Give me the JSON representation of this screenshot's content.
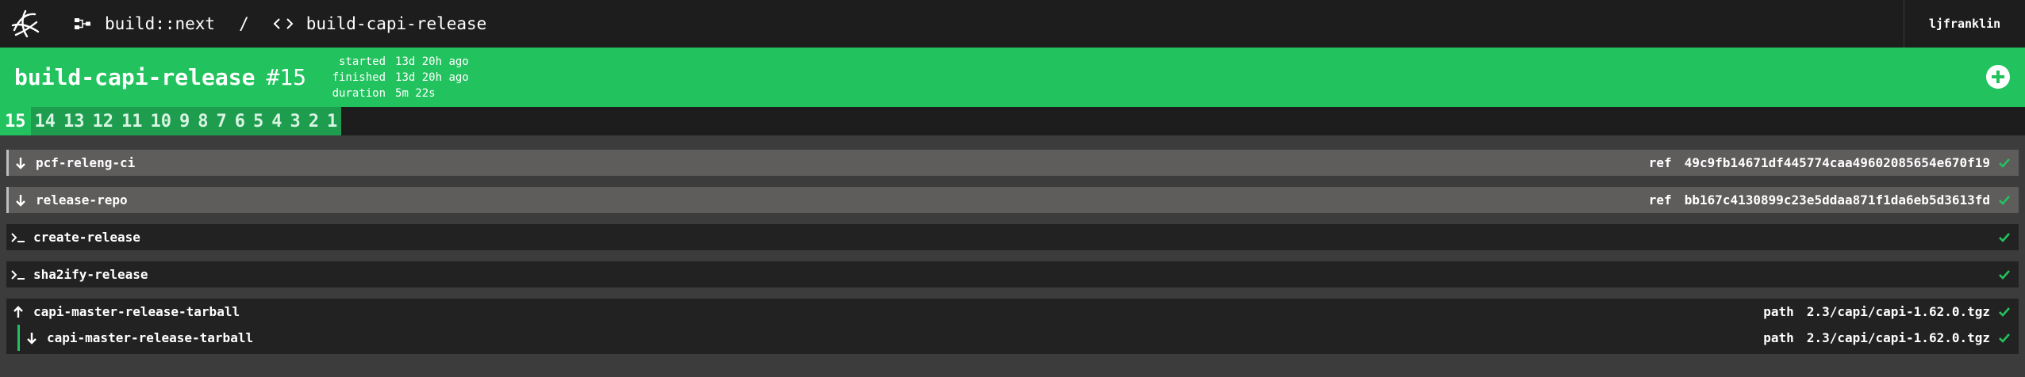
{
  "nav": {
    "pipeline": "build::next",
    "separator": "/",
    "job": "build-capi-release",
    "user": "ljfranklin"
  },
  "build": {
    "name": "build-capi-release",
    "number": "#15",
    "started_label": "started",
    "started_value": "13d 20h ago",
    "finished_label": "finished",
    "finished_value": "13d 20h ago",
    "duration_label": "duration",
    "duration_value": "5m 22s"
  },
  "build_tabs": [
    "15",
    "14",
    "13",
    "12",
    "11",
    "10",
    "9",
    "8",
    "7",
    "6",
    "5",
    "4",
    "3",
    "2",
    "1"
  ],
  "steps": [
    {
      "type": "get",
      "name": "pcf-releng-ci",
      "key": "ref",
      "value": "49c9fb14671df445774caa49602085654e670f19"
    },
    {
      "type": "get",
      "name": "release-repo",
      "key": "ref",
      "value": "bb167c4130899c23e5ddaa871f1da6eb5d3613fd"
    },
    {
      "type": "task",
      "name": "create-release"
    },
    {
      "type": "task",
      "name": "sha2ify-release"
    },
    {
      "type": "put",
      "name": "capi-master-release-tarball",
      "key": "path",
      "value": "2.3/capi/capi-1.62.0.tgz"
    },
    {
      "type": "get",
      "name": "capi-master-release-tarball",
      "key": "path",
      "value": "2.3/capi/capi-1.62.0.tgz"
    }
  ],
  "colors": {
    "success": "#22c35e",
    "nav_bg": "#1e1d1d",
    "page_bg": "#3d3c3c"
  }
}
